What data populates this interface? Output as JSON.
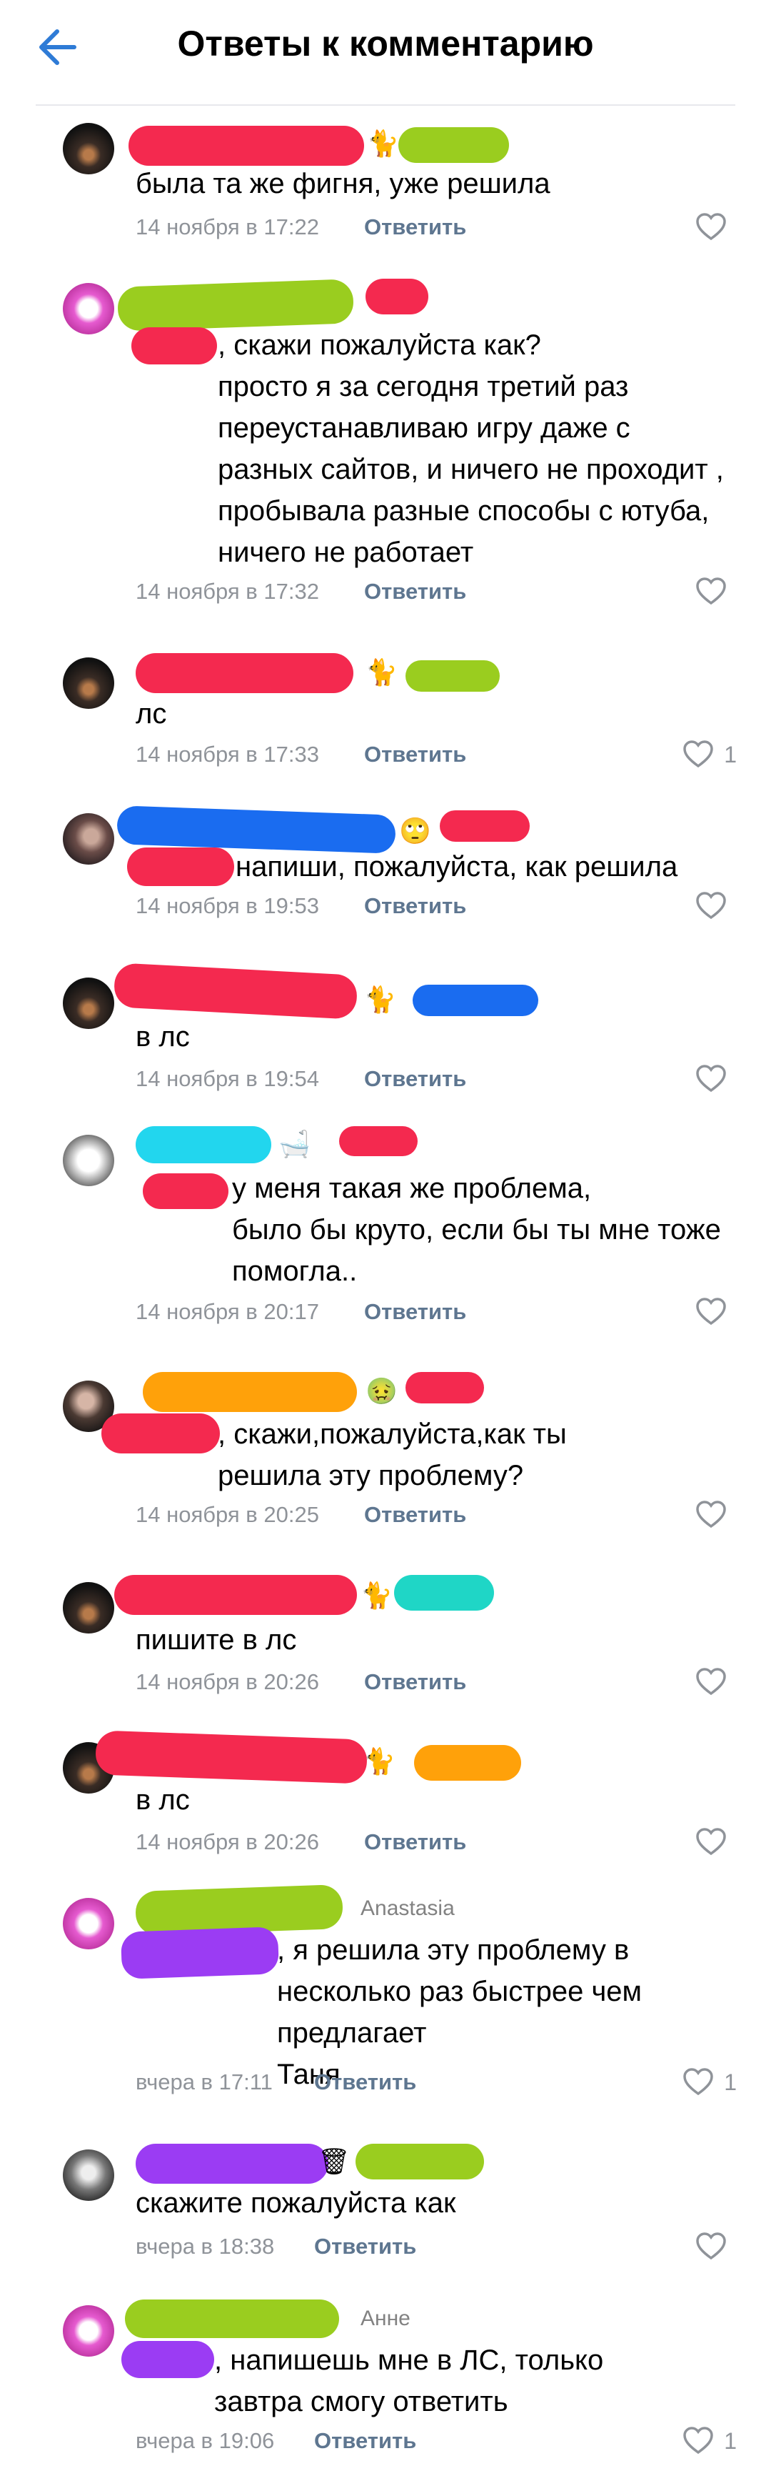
{
  "header": {
    "title": "Ответы к комментарию",
    "back_icon": "arrow-left-icon"
  },
  "colors": {
    "accent": "#2e7bd6",
    "meta": "#8f9399",
    "reply": "#5e7690"
  },
  "reply_label": "Ответить",
  "comments": [
    {
      "text": "была та же фигня, уже решила",
      "date": "14 ноября в 17:22",
      "likes": ""
    },
    {
      "text": ", скажи пожалуйста как?\nпросто я за сегодня третий раз\nпереустанавливаю игру даже с\nразных сайтов, и ничего не проходит ,\nпробывала разные способы с ютуба,\nничего не работает",
      "date": "14 ноября в 17:32",
      "likes": ""
    },
    {
      "text": "лс",
      "date": "14 ноября в 17:33",
      "likes": "1"
    },
    {
      "text": "напиши, пожалуйста, как решила",
      "date": "14 ноября в 19:53",
      "likes": ""
    },
    {
      "text": "в лс",
      "date": "14 ноября в 19:54",
      "likes": ""
    },
    {
      "text": "у меня такая же проблема,\nбыло бы круто, если бы ты мне тоже\nпомогла..",
      "date": "14 ноября в 20:17",
      "likes": ""
    },
    {
      "text": ", скажи,пожалуйста,как ты\nрешила эту проблему?",
      "date": "14 ноября в 20:25",
      "likes": ""
    },
    {
      "text": "пишите в лс",
      "date": "14 ноября в 20:26",
      "likes": ""
    },
    {
      "text": "в лс",
      "date": "14 ноября в 20:26",
      "likes": ""
    },
    {
      "reply_to": "Anastasia",
      "text": ", я решила эту проблему в\nнесколько раз быстрее чем предлагает\nТаня",
      "date": "вчера в 17:11",
      "likes": "1"
    },
    {
      "text": "скажите пожалуйста как",
      "date": "вчера в 18:38",
      "likes": ""
    },
    {
      "reply_to": "Анне",
      "text": ", напишешь мне в ЛС, только\nзавтра смогу ответить",
      "date": "вчера в 19:06",
      "likes": "1"
    }
  ]
}
